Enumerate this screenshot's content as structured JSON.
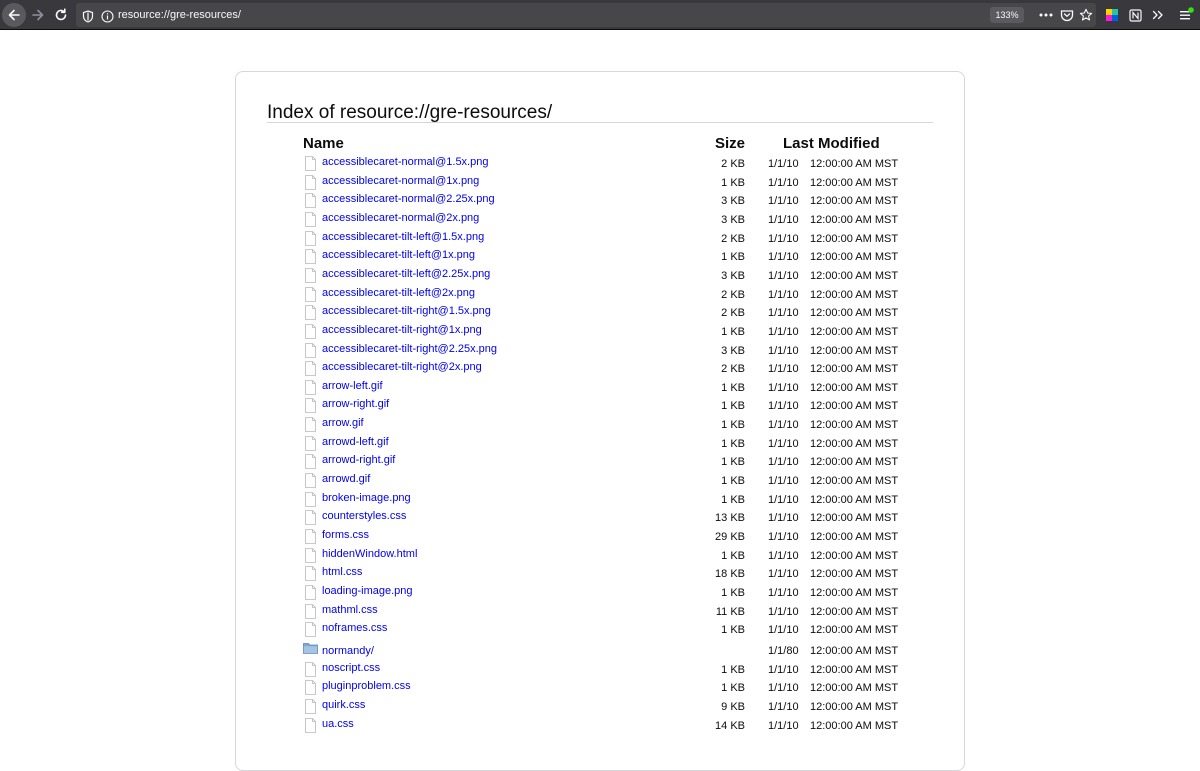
{
  "browser": {
    "url": "resource://gre-resources/",
    "zoom": "133%"
  },
  "page": {
    "title": "Index of resource://gre-resources/",
    "columns": {
      "name": "Name",
      "size": "Size",
      "modified": "Last Modified"
    },
    "entries": [
      {
        "name": "accessiblecaret-normal@1.5x.png",
        "size": "2 KB",
        "date": "1/1/10",
        "time": "12:00:00 AM MST",
        "type": "file"
      },
      {
        "name": "accessiblecaret-normal@1x.png",
        "size": "1 KB",
        "date": "1/1/10",
        "time": "12:00:00 AM MST",
        "type": "file"
      },
      {
        "name": "accessiblecaret-normal@2.25x.png",
        "size": "3 KB",
        "date": "1/1/10",
        "time": "12:00:00 AM MST",
        "type": "file"
      },
      {
        "name": "accessiblecaret-normal@2x.png",
        "size": "3 KB",
        "date": "1/1/10",
        "time": "12:00:00 AM MST",
        "type": "file"
      },
      {
        "name": "accessiblecaret-tilt-left@1.5x.png",
        "size": "2 KB",
        "date": "1/1/10",
        "time": "12:00:00 AM MST",
        "type": "file"
      },
      {
        "name": "accessiblecaret-tilt-left@1x.png",
        "size": "1 KB",
        "date": "1/1/10",
        "time": "12:00:00 AM MST",
        "type": "file"
      },
      {
        "name": "accessiblecaret-tilt-left@2.25x.png",
        "size": "3 KB",
        "date": "1/1/10",
        "time": "12:00:00 AM MST",
        "type": "file"
      },
      {
        "name": "accessiblecaret-tilt-left@2x.png",
        "size": "2 KB",
        "date": "1/1/10",
        "time": "12:00:00 AM MST",
        "type": "file"
      },
      {
        "name": "accessiblecaret-tilt-right@1.5x.png",
        "size": "2 KB",
        "date": "1/1/10",
        "time": "12:00:00 AM MST",
        "type": "file"
      },
      {
        "name": "accessiblecaret-tilt-right@1x.png",
        "size": "1 KB",
        "date": "1/1/10",
        "time": "12:00:00 AM MST",
        "type": "file"
      },
      {
        "name": "accessiblecaret-tilt-right@2.25x.png",
        "size": "3 KB",
        "date": "1/1/10",
        "time": "12:00:00 AM MST",
        "type": "file"
      },
      {
        "name": "accessiblecaret-tilt-right@2x.png",
        "size": "2 KB",
        "date": "1/1/10",
        "time": "12:00:00 AM MST",
        "type": "file"
      },
      {
        "name": "arrow-left.gif",
        "size": "1 KB",
        "date": "1/1/10",
        "time": "12:00:00 AM MST",
        "type": "file"
      },
      {
        "name": "arrow-right.gif",
        "size": "1 KB",
        "date": "1/1/10",
        "time": "12:00:00 AM MST",
        "type": "file"
      },
      {
        "name": "arrow.gif",
        "size": "1 KB",
        "date": "1/1/10",
        "time": "12:00:00 AM MST",
        "type": "file"
      },
      {
        "name": "arrowd-left.gif",
        "size": "1 KB",
        "date": "1/1/10",
        "time": "12:00:00 AM MST",
        "type": "file"
      },
      {
        "name": "arrowd-right.gif",
        "size": "1 KB",
        "date": "1/1/10",
        "time": "12:00:00 AM MST",
        "type": "file"
      },
      {
        "name": "arrowd.gif",
        "size": "1 KB",
        "date": "1/1/10",
        "time": "12:00:00 AM MST",
        "type": "file"
      },
      {
        "name": "broken-image.png",
        "size": "1 KB",
        "date": "1/1/10",
        "time": "12:00:00 AM MST",
        "type": "file"
      },
      {
        "name": "counterstyles.css",
        "size": "13 KB",
        "date": "1/1/10",
        "time": "12:00:00 AM MST",
        "type": "file"
      },
      {
        "name": "forms.css",
        "size": "29 KB",
        "date": "1/1/10",
        "time": "12:00:00 AM MST",
        "type": "file"
      },
      {
        "name": "hiddenWindow.html",
        "size": "1 KB",
        "date": "1/1/10",
        "time": "12:00:00 AM MST",
        "type": "file"
      },
      {
        "name": "html.css",
        "size": "18 KB",
        "date": "1/1/10",
        "time": "12:00:00 AM MST",
        "type": "file"
      },
      {
        "name": "loading-image.png",
        "size": "1 KB",
        "date": "1/1/10",
        "time": "12:00:00 AM MST",
        "type": "file"
      },
      {
        "name": "mathml.css",
        "size": "11 KB",
        "date": "1/1/10",
        "time": "12:00:00 AM MST",
        "type": "file"
      },
      {
        "name": "noframes.css",
        "size": "1 KB",
        "date": "1/1/10",
        "time": "12:00:00 AM MST",
        "type": "file"
      },
      {
        "name": "normandy/",
        "size": "",
        "date": "1/1/80",
        "time": "12:00:00 AM MST",
        "type": "folder"
      },
      {
        "name": "noscript.css",
        "size": "1 KB",
        "date": "1/1/10",
        "time": "12:00:00 AM MST",
        "type": "file"
      },
      {
        "name": "pluginproblem.css",
        "size": "1 KB",
        "date": "1/1/10",
        "time": "12:00:00 AM MST",
        "type": "file"
      },
      {
        "name": "quirk.css",
        "size": "9 KB",
        "date": "1/1/10",
        "time": "12:00:00 AM MST",
        "type": "file"
      },
      {
        "name": "ua.css",
        "size": "14 KB",
        "date": "1/1/10",
        "time": "12:00:00 AM MST",
        "type": "file"
      }
    ]
  }
}
